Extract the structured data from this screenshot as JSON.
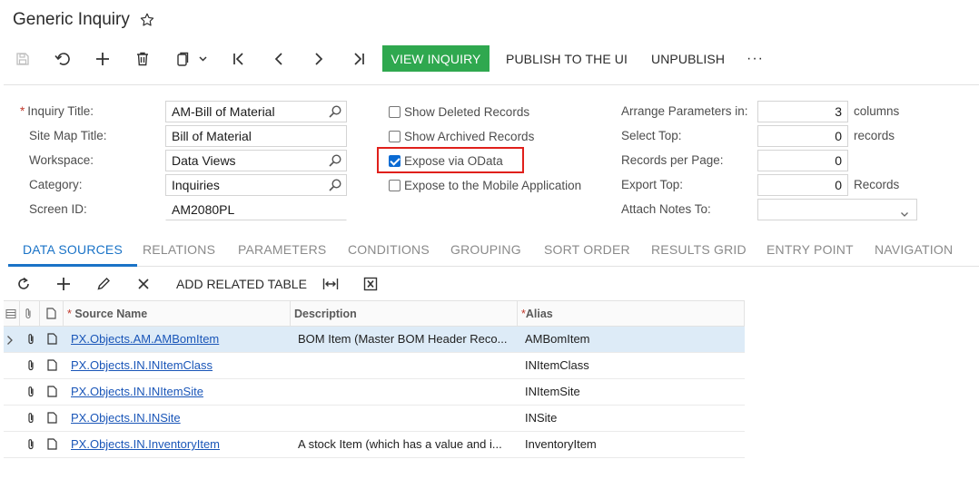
{
  "header": {
    "title": "Generic Inquiry"
  },
  "toolbar": {
    "view_inquiry": "VIEW INQUIRY",
    "publish": "PUBLISH TO THE UI",
    "unpublish": "UNPUBLISH",
    "more": "···"
  },
  "form": {
    "inquiry_title_label": "Inquiry Title:",
    "inquiry_title_value": "AM-Bill of Material",
    "site_map_title_label": "Site Map Title:",
    "site_map_title_value": "Bill of Material",
    "workspace_label": "Workspace:",
    "workspace_value": "Data Views",
    "category_label": "Category:",
    "category_value": "Inquiries",
    "screen_id_label": "Screen ID:",
    "screen_id_value": "AM2080PL",
    "show_deleted": "Show Deleted Records",
    "show_archived": "Show Archived Records",
    "expose_odata": "Expose via OData",
    "expose_mobile": "Expose to the Mobile Application",
    "arrange_label": "Arrange Parameters in:",
    "arrange_value": "3",
    "arrange_unit": "columns",
    "select_top_label": "Select Top:",
    "select_top_value": "0",
    "select_top_unit": "records",
    "records_page_label": "Records per Page:",
    "records_page_value": "0",
    "export_top_label": "Export Top:",
    "export_top_value": "0",
    "export_top_unit": "Records",
    "attach_notes_label": "Attach Notes To:",
    "attach_notes_value": ""
  },
  "checkbox_states": {
    "show_deleted": false,
    "show_archived": false,
    "expose_odata": true,
    "expose_mobile": false
  },
  "tabs": [
    "DATA SOURCES",
    "RELATIONS",
    "PARAMETERS",
    "CONDITIONS",
    "GROUPING",
    "SORT ORDER",
    "RESULTS GRID",
    "ENTRY POINT",
    "NAVIGATION"
  ],
  "grid_toolbar": {
    "add_related": "ADD RELATED TABLE"
  },
  "grid": {
    "columns": {
      "source_name": "Source Name",
      "description": "Description",
      "alias": "Alias"
    },
    "rows": [
      {
        "source": "PX.Objects.AM.AMBomItem",
        "description": "BOM Item (Master BOM Header Reco...",
        "alias": "AMBomItem"
      },
      {
        "source": "PX.Objects.IN.INItemClass",
        "description": "",
        "alias": "INItemClass"
      },
      {
        "source": "PX.Objects.IN.INItemSite",
        "description": "",
        "alias": "INItemSite"
      },
      {
        "source": "PX.Objects.IN.INSite",
        "description": "",
        "alias": "INSite"
      },
      {
        "source": "PX.Objects.IN.InventoryItem",
        "description": "A stock Item (which has a value and i...",
        "alias": "InventoryItem"
      }
    ]
  },
  "colors": {
    "accent": "#2fa84f",
    "link": "#1a56b8",
    "tab_active": "#1a73c7",
    "highlight": "#e0201b"
  }
}
